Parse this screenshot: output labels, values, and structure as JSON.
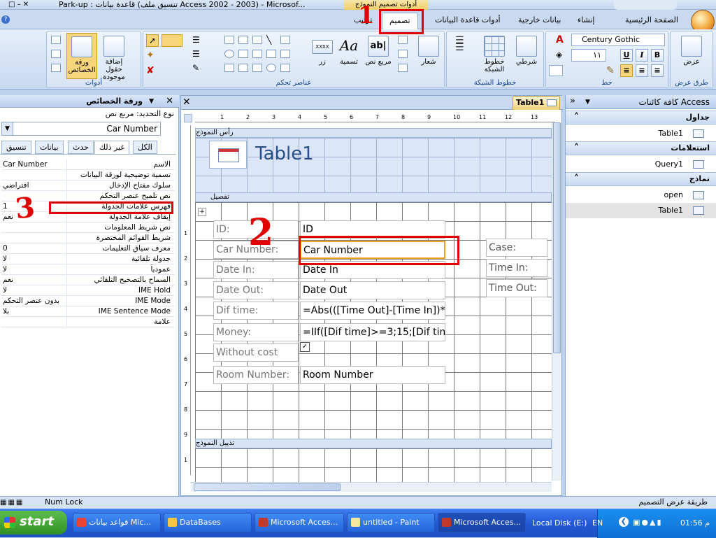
{
  "window": {
    "title": "Park-up : قاعدة بيانات (تنسيق ملف Access 2002 - 2003) - Microsof...",
    "context_band": "أدوات تصميم النموذج"
  },
  "ribbon_tabs": [
    "الصفحة الرئيسية",
    "إنشاء",
    "بيانات خارجية",
    "أدوات قاعدة البيانات",
    "تصميم",
    "ترتيب"
  ],
  "ribbon_tab_active": "تصميم",
  "groups": {
    "views": {
      "caption": "طرق عرض",
      "view_label": "عرض"
    },
    "font": {
      "caption": "خط",
      "font_name": "Century Gothic",
      "font_size": "١١",
      "bold": "B",
      "italic": "I",
      "underline": "U"
    },
    "gridlines": {
      "caption": "خطوط الشبكة",
      "conditional_label": "شرطي",
      "gridlines_label": "خطوط الشبكة"
    },
    "controls": {
      "caption": "عناصر تحكم",
      "logo_label": "شعار",
      "textbox_label": "مربع نص",
      "title_label": "تسمية",
      "button_label": "زر",
      "aa_glyph": "Aa",
      "ab_glyph": "ab|",
      "xxxx_glyph": "XXXX"
    },
    "tools": {
      "caption": "أدوات",
      "add_fields_label": "إضافة حقول موجودة",
      "property_sheet_label": "ورقة الخصائص"
    }
  },
  "property_sheet": {
    "title": "ورقة الخصائص",
    "selection_type_label": "نوع التحديد:",
    "selection_type_value": "مربع نص",
    "selected_control": "Car Number",
    "tabs": [
      "الكل",
      "غير ذلك",
      "حدث",
      "بيانات",
      "تنسيق"
    ],
    "active_tab": "غير ذلك",
    "rows": [
      {
        "name": "الاسم",
        "value": "Car Number"
      },
      {
        "name": "تسمية توضيحية لورقة البيانات",
        "value": ""
      },
      {
        "name": "سلوك مفتاح الإدخال",
        "value": "افتراضي"
      },
      {
        "name": "نص تلميح عنصر التحكم",
        "value": ""
      },
      {
        "name": "فهرس علامات الجدولة",
        "value": "1"
      },
      {
        "name": "إيقاف علامة الجدولة",
        "value": "نعم"
      },
      {
        "name": "نص شريط المعلومات",
        "value": ""
      },
      {
        "name": "شريط القوائم المختصرة",
        "value": ""
      },
      {
        "name": "معرف سياق التعليمات",
        "value": "0"
      },
      {
        "name": "جدولة تلقائية",
        "value": "لا"
      },
      {
        "name": "عمودياً",
        "value": "لا"
      },
      {
        "name": "السماح بالتصحيح التلقائي",
        "value": "نعم"
      },
      {
        "name": "IME Hold",
        "value": "لا"
      },
      {
        "name": "IME Mode",
        "value": "بدون عنصر التحكم"
      },
      {
        "name": "IME Sentence Mode",
        "value": "بلا"
      },
      {
        "name": "علامة",
        "value": ""
      }
    ]
  },
  "document": {
    "tab_title": "Table1",
    "ruler_marks": [
      "1",
      "2",
      "3",
      "4",
      "5",
      "6",
      "7",
      "8",
      "9",
      "10",
      "11",
      "12",
      "13"
    ],
    "vruler_marks": [
      "1",
      "2",
      "3",
      "4",
      "5",
      "6",
      "7",
      "8",
      "9",
      "1"
    ],
    "sections": {
      "header": "رأس النموذج",
      "detail": "تفصيل",
      "footer": "تذييل النموذج"
    },
    "form_title": "Table1",
    "fields": [
      {
        "label": "ID:",
        "control": "ID"
      },
      {
        "label": "Car Number:",
        "control": "Car Number"
      },
      {
        "label": "Date In:",
        "control": "Date In"
      },
      {
        "label": "Date Out:",
        "control": "Date Out"
      },
      {
        "label": "Dif time:",
        "control": "=Abs(([Time Out]-[Time In])*2"
      },
      {
        "label": "Money:",
        "control": "=IIf([Dif time]>=3;15;[Dif time"
      },
      {
        "label": "Without cost",
        "control": "✓"
      },
      {
        "label": "Room Number:",
        "control": "Room Number"
      }
    ],
    "right_labels": [
      "Case:",
      "Time In:",
      "Time Out:"
    ]
  },
  "annotations": {
    "n1": "1",
    "n2": "2",
    "n3": "3"
  },
  "nav_pane": {
    "title": "كافة كائنات Access",
    "sections": [
      {
        "name": "جداول",
        "items": [
          "Table1"
        ]
      },
      {
        "name": "استعلامات",
        "items": [
          "Query1"
        ]
      },
      {
        "name": "نماذج",
        "items": [
          "open",
          "Table1"
        ]
      }
    ]
  },
  "status": {
    "mode": "طريقة عرض التصميم",
    "numlock": "Num Lock"
  },
  "taskbar": {
    "start": "start",
    "tasks": [
      "قواعد بيانات Mic...",
      "DataBases",
      "Microsoft Acces...",
      "untitled - Paint",
      "Microsoft Acces..."
    ],
    "active_task_index": 4,
    "drive": "Local Disk (E:)",
    "lang": "EN",
    "clock": "01:56 م"
  }
}
